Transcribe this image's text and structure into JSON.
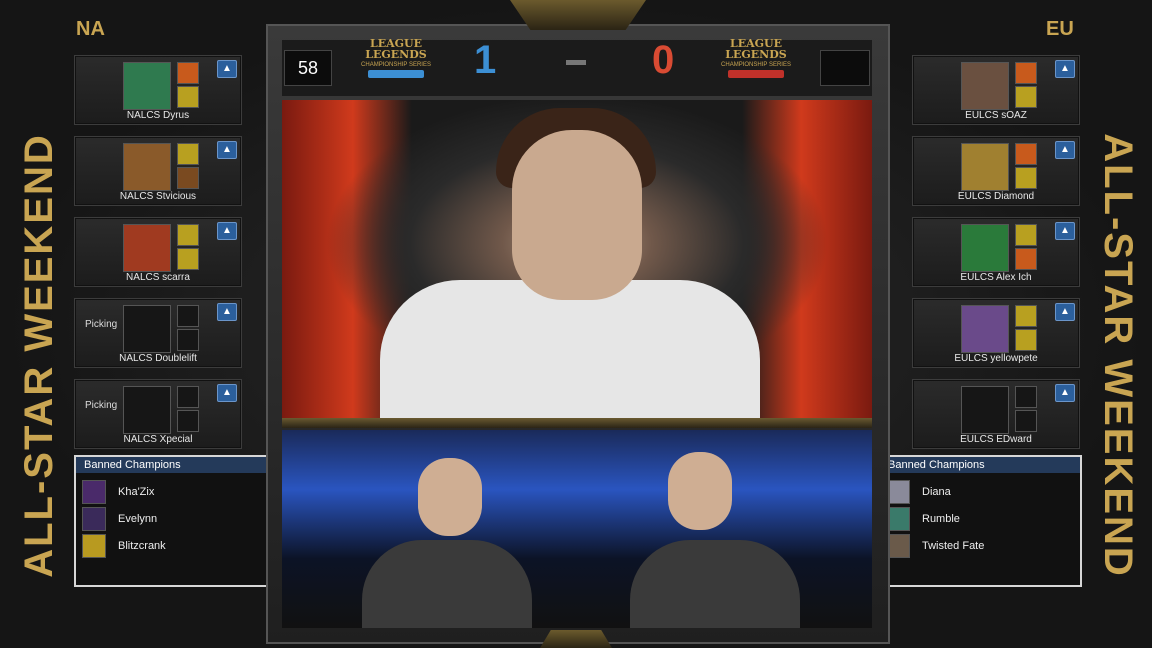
{
  "regions": {
    "left": "NA",
    "right": "EU"
  },
  "banner_text": "ALL-STAR WEEKEND",
  "scoreboard": {
    "timer": "58",
    "left_logo": {
      "line1": "LEAGUE",
      "line2": "LEGENDS",
      "sub": "CHAMPIONSHIP SERIES",
      "ribbon_color": "#3c8fd4"
    },
    "right_logo": {
      "line1": "LEAGUE",
      "line2": "LEGENDS",
      "sub": "CHAMPIONSHIP SERIES",
      "ribbon_color": "#c0312a"
    },
    "score_left": "1",
    "score_right": "0",
    "separator": "-"
  },
  "na_players": [
    {
      "name": "NALCS Dyrus",
      "status": "",
      "champion_color": "#2f7a4f",
      "spell1_color": "#c85a1c",
      "spell2_color": "#b8a020"
    },
    {
      "name": "NALCS Stvicious",
      "status": "",
      "champion_color": "#8a5a2a",
      "spell1_color": "#b8a020",
      "spell2_color": "#7a4a20"
    },
    {
      "name": "NALCS scarra",
      "status": "",
      "champion_color": "#a03a20",
      "spell1_color": "#b8a020",
      "spell2_color": "#b8a020"
    },
    {
      "name": "NALCS Doublelift",
      "status": "Picking",
      "champion_color": "",
      "spell1_color": "",
      "spell2_color": ""
    },
    {
      "name": "NALCS Xpecial",
      "status": "Picking",
      "champion_color": "",
      "spell1_color": "",
      "spell2_color": ""
    }
  ],
  "eu_players": [
    {
      "name": "EULCS sOAZ",
      "status": "",
      "champion_color": "#6a5040",
      "spell1_color": "#c85a1c",
      "spell2_color": "#b8a020"
    },
    {
      "name": "EULCS Diamond",
      "status": "",
      "champion_color": "#a08030",
      "spell1_color": "#c85a1c",
      "spell2_color": "#b8a020"
    },
    {
      "name": "EULCS Alex Ich",
      "status": "",
      "champion_color": "#2a7a3a",
      "spell1_color": "#b8a020",
      "spell2_color": "#c85a1c"
    },
    {
      "name": "EULCS yellowpete",
      "status": "",
      "champion_color": "#6a4a8a",
      "spell1_color": "#b8a020",
      "spell2_color": "#b8a020"
    },
    {
      "name": "EULCS EDward",
      "status": "",
      "champion_color": "",
      "spell1_color": "",
      "spell2_color": ""
    }
  ],
  "na_bans": {
    "header": "Banned Champions",
    "items": [
      {
        "name": "Kha'Zix",
        "color": "#4a2a6a"
      },
      {
        "name": "Evelynn",
        "color": "#3a2a5a"
      },
      {
        "name": "Blitzcrank",
        "color": "#b89a20"
      }
    ]
  },
  "eu_bans": {
    "header": "Banned Champions",
    "items": [
      {
        "name": "Diana",
        "color": "#8a8a9a"
      },
      {
        "name": "Rumble",
        "color": "#3a7a6a"
      },
      {
        "name": "Twisted Fate",
        "color": "#6a5a4a"
      }
    ]
  },
  "colors": {
    "gold": "#c9a552",
    "na_blue": "#3c8fd4",
    "eu_red": "#d94b33"
  },
  "icons": {
    "player": "player-profile-icon"
  }
}
